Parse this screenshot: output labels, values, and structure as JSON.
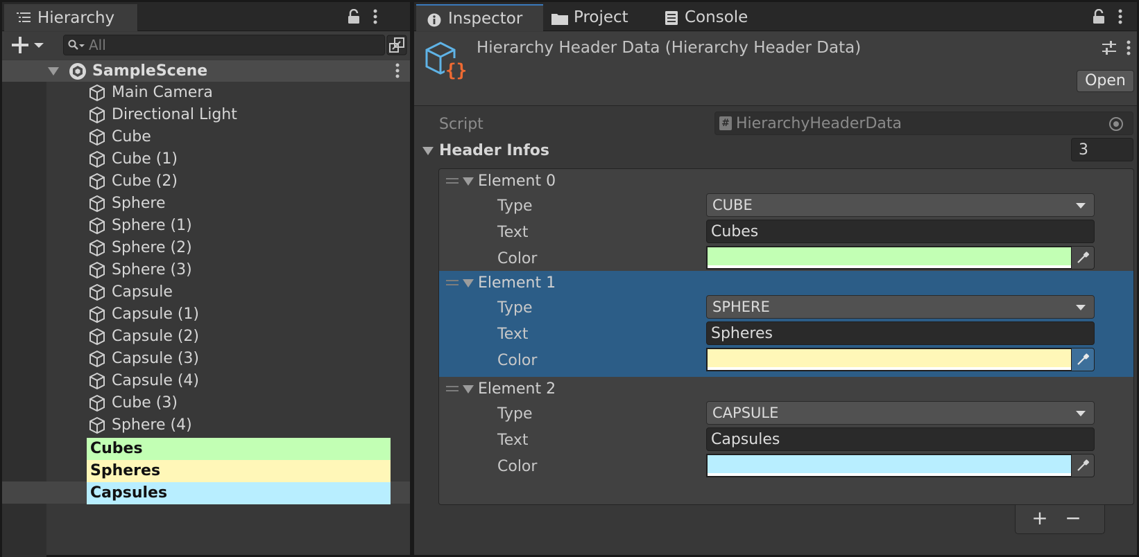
{
  "hierarchy": {
    "tab_label": "Hierarchy",
    "search_placeholder": "All",
    "scene_name": "SampleScene",
    "items": [
      "Main Camera",
      "Directional Light",
      "Cube",
      "Cube (1)",
      "Cube (2)",
      "Sphere",
      "Sphere (1)",
      "Sphere (2)",
      "Sphere (3)",
      "Capsule",
      "Capsule (1)",
      "Capsule (2)",
      "Capsule (3)",
      "Capsule (4)",
      "Cube (3)",
      "Sphere (4)"
    ],
    "headers": [
      {
        "label": "Cubes",
        "color": "#c2ffb4"
      },
      {
        "label": "Spheres",
        "color": "#fff7b8"
      },
      {
        "label": "Capsules",
        "color": "#b8eeff"
      }
    ]
  },
  "inspector": {
    "tabs": [
      "Inspector",
      "Project",
      "Console"
    ],
    "object_title": "Hierarchy Header Data (Hierarchy Header Data)",
    "open_label": "Open",
    "script_label": "Script",
    "script_value": "HierarchyHeaderData",
    "header_infos_label": "Header Infos",
    "header_infos_count": "3",
    "type_label": "Type",
    "text_label": "Text",
    "color_label": "Color",
    "elements": [
      {
        "title": "Element 0",
        "type": "CUBE",
        "text": "Cubes",
        "color": "#c2ffb4"
      },
      {
        "title": "Element 1",
        "type": "SPHERE",
        "text": "Spheres",
        "color": "#fff7b8"
      },
      {
        "title": "Element 2",
        "type": "CAPSULE",
        "text": "Capsules",
        "color": "#b8eeff"
      }
    ],
    "add_label": "+",
    "remove_label": "−"
  }
}
